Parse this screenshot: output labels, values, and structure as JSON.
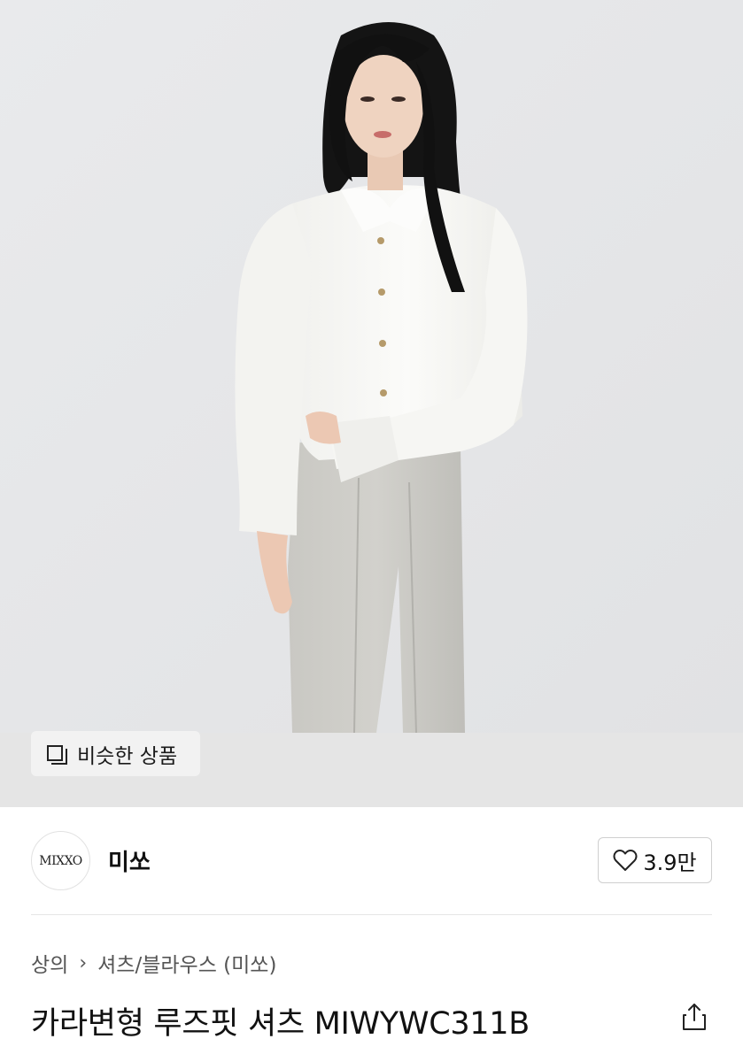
{
  "hero": {
    "image_alt": "model wearing white shirt and grey trousers",
    "similar_button_label": "비슷한 상품",
    "similar_icon": "duplicate-icon"
  },
  "brand": {
    "logo_text": "MIXXO",
    "name": "미쏘",
    "like_count": "3.9만",
    "like_icon": "heart-outline-icon"
  },
  "breadcrumb": {
    "items": [
      "상의",
      "셔츠/블라우스 (미쏘)"
    ],
    "separator_icon": "chevron-right-icon"
  },
  "product": {
    "title": "카라변형 루즈핏 셔츠 MIWYWC311B",
    "share_icon": "share-icon"
  },
  "colors": {
    "background": "#ffffff",
    "hero_background": "#e7e8ea",
    "strip_background": "#e5e5e5",
    "text_primary": "#111111",
    "text_secondary": "#555555",
    "border": "#cfcfcf"
  }
}
